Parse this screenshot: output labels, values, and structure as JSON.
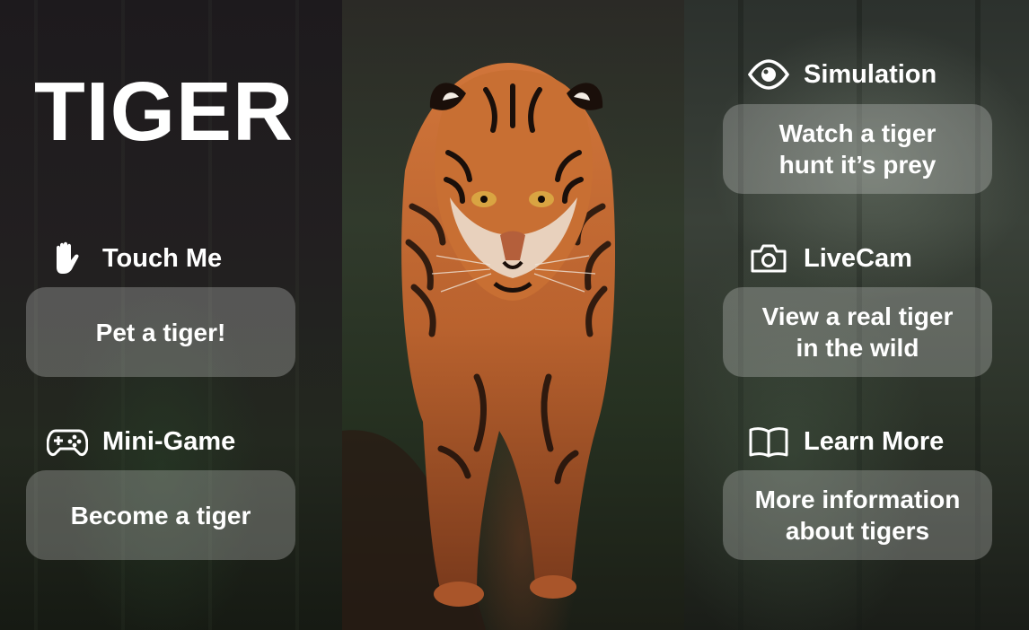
{
  "title": "TIGER",
  "left": {
    "touch": {
      "label": "Touch Me",
      "icon": "hand-icon",
      "card": "Pet a tiger!"
    },
    "game": {
      "label": "Mini-Game",
      "icon": "gamepad-icon",
      "card": "Become a tiger"
    }
  },
  "right": {
    "simulation": {
      "label": "Simulation",
      "icon": "eye-icon",
      "card_line1": "Watch a tiger",
      "card_line2": "hunt it’s prey"
    },
    "livecam": {
      "label": "LiveCam",
      "icon": "camera-icon",
      "card_line1": "View a real tiger",
      "card_line2": "in the wild"
    },
    "learn": {
      "label": "Learn More",
      "icon": "book-icon",
      "card_line1": "More information",
      "card_line2": "about tigers"
    }
  },
  "colors": {
    "text": "#ffffff",
    "card_fill": "rgba(255,255,255,0.24)",
    "tiger_orange": "#c8692c"
  }
}
